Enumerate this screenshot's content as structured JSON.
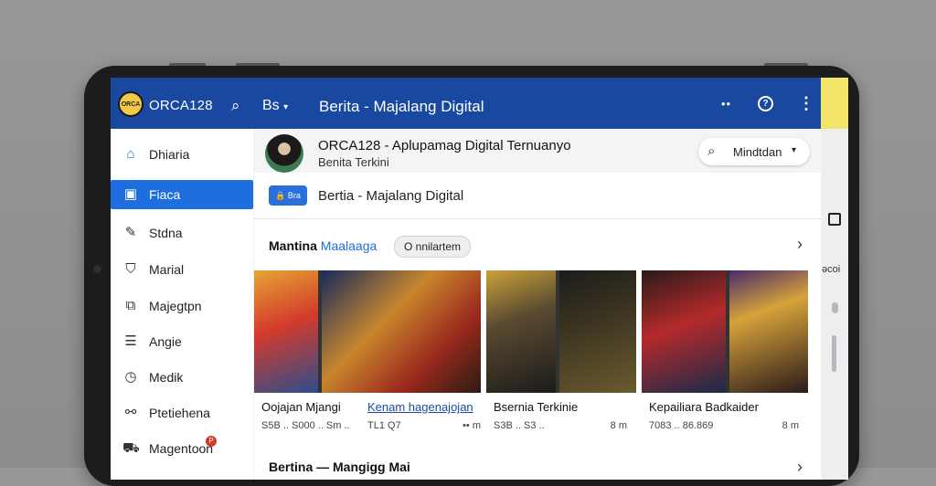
{
  "topbar": {
    "logo_text": "ORCA",
    "app_name": "ORCA128",
    "lang": "Bs",
    "title": "Berita - Majalang Digital"
  },
  "sidebar": {
    "items": [
      {
        "label": "Dhiaria",
        "icon": "home-icon"
      },
      {
        "label": "Fiaca",
        "icon": "square-icon",
        "active": true
      },
      {
        "label": "Stdna",
        "icon": "edit-icon"
      },
      {
        "label": "Marial",
        "icon": "bookmark-icon"
      },
      {
        "label": "Majegtpn",
        "icon": "magazine-icon"
      },
      {
        "label": "Angie",
        "icon": "list-icon"
      },
      {
        "label": "Medik",
        "icon": "clock-icon"
      },
      {
        "label": "Ptetiehena",
        "icon": "link-icon"
      },
      {
        "label": "Magentoon",
        "icon": "bag-icon",
        "badge": "P"
      }
    ]
  },
  "channel": {
    "title": "ORCA128 - Aplupamag Digital Ternuanyo",
    "subtitle": "Benita Terkini",
    "filter_label": "Mindtdan"
  },
  "magazine": {
    "chip": "Bra",
    "title": "Bertia - Majalang Digital"
  },
  "section": {
    "heading": "Mantina",
    "heading_accent": "Maalaaga",
    "tag": "O nnilartem"
  },
  "cards": [
    {
      "title": "Oojajan Mjangi",
      "meta": "S5B .. S000 .. Sm ..",
      "more": ""
    },
    {
      "title": "Kenam hagenajojan",
      "meta": "TL1 Q7",
      "more": "•• m"
    },
    {
      "title": "Bsernia Terkinie",
      "meta": "S3B .. S3 ..",
      "more": "8 m"
    },
    {
      "title": "Kepailiara Badkaider",
      "meta": "7083 .. 86.869",
      "more": "8 m"
    }
  ],
  "next_section": {
    "heading": "Bertina — Mangigg Mai"
  },
  "rail": {
    "text": "əcoi"
  },
  "colors": {
    "topbar": "#1848a0",
    "accent": "#1e6ee0",
    "strip": "#f2e56a"
  }
}
